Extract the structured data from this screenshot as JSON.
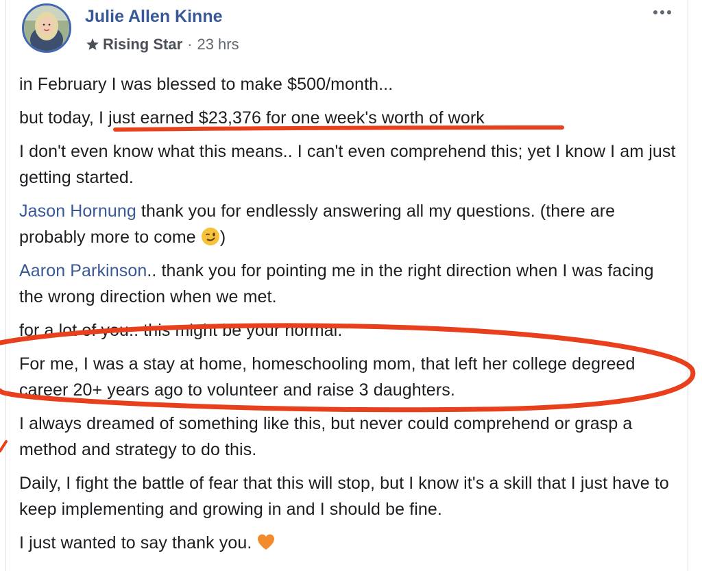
{
  "post": {
    "author_name": "Julie Allen Kinne",
    "badge_icon": "star-badge-icon",
    "badge_label": "Rising Star",
    "separator": "·",
    "timestamp": "23 hrs",
    "more_icon": "more-options-icon"
  },
  "content": {
    "p1": "in February I was blessed to make $500/month...",
    "p2_prefix": "but today, ",
    "p2_highlight": "I just earned $23,376 for one week's worth of work",
    "p3": "I don't even know what this means.. I can't even comprehend this; yet I know I am just getting started.",
    "p4_mention": "Jason Hornung",
    "p4_text": " thank you for endlessly answering all my questions. (there are probably more to come ",
    "p4_end": ")",
    "p5_mention": "Aaron Parkinson",
    "p5_text": ".. thank you for pointing me in the right direction when I was facing the wrong direction when we met.",
    "p6": "for a lot of you.. this might be your normal.",
    "p7": "For me, I was a stay at home, homeschooling mom, that left her college degreed career 20+ years ago to volunteer and raise 3 daughters.",
    "p8": "I always dreamed of something like this, but never could comprehend or grasp a method and strategy to do this.",
    "p9": "Daily, I fight the battle of fear that this will stop, but I know it's a skill that I just have to keep implementing and growing in and I should be fine.",
    "p10": "I just wanted to say thank you. ",
    "wink_emoji": "winking-face-emoji",
    "heart_emoji": "orange-heart-emoji"
  },
  "annotation_color": "#e8401c",
  "link_color": "#385898"
}
